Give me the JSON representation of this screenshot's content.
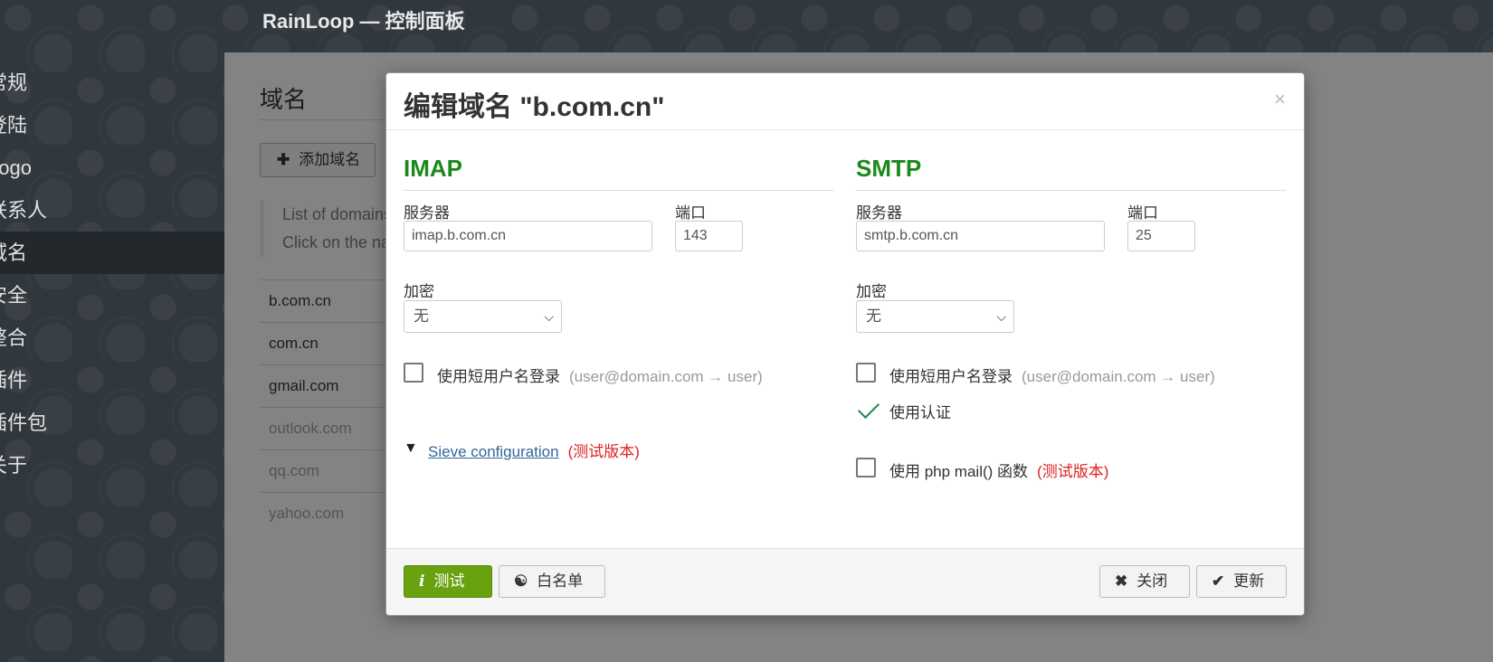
{
  "app": {
    "title": "RainLoop — 控制面板"
  },
  "menu": {
    "items": [
      {
        "label": "常规",
        "active": false
      },
      {
        "label": "登陆",
        "active": false
      },
      {
        "label": "Logo",
        "active": false
      },
      {
        "label": "联系人",
        "active": false
      },
      {
        "label": "域名",
        "active": true
      },
      {
        "label": "安全",
        "active": false
      },
      {
        "label": "整合",
        "active": false
      },
      {
        "label": "插件",
        "active": false
      },
      {
        "label": "插件包",
        "active": false
      },
      {
        "label": "关于",
        "active": false
      }
    ]
  },
  "domains": {
    "title": "域名",
    "add_button": "添加域名",
    "info_line1": "List of domains",
    "info_line2": "Click on the name",
    "list": [
      {
        "name": "b.com.cn",
        "enabled": true
      },
      {
        "name": "com.cn",
        "enabled": true
      },
      {
        "name": "gmail.com",
        "enabled": true
      },
      {
        "name": "outlook.com",
        "enabled": false
      },
      {
        "name": "qq.com",
        "enabled": false
      },
      {
        "name": "yahoo.com",
        "enabled": false
      }
    ]
  },
  "modal": {
    "title": "编辑域名 \"b.com.cn\"",
    "close": "×",
    "imap": {
      "heading": "IMAP",
      "server_label": "服务器",
      "server_value": "imap.b.com.cn",
      "port_label": "端口",
      "port_value": "143",
      "encryption_label": "加密",
      "encryption_value": "无",
      "short_login_label": "使用短用户名登录",
      "short_login_hint": "(user@domain.com → user)",
      "sieve_link": "Sieve configuration",
      "sieve_beta": "(测试版本)"
    },
    "smtp": {
      "heading": "SMTP",
      "server_label": "服务器",
      "server_value": "smtp.b.com.cn",
      "port_label": "端口",
      "port_value": "25",
      "encryption_label": "加密",
      "encryption_value": "无",
      "short_login_label": "使用短用户名登录",
      "short_login_hint": "(user@domain.com → user)",
      "auth_label": "使用认证",
      "php_mail_label": "使用 php mail() 函数",
      "php_mail_beta": "(测试版本)"
    },
    "footer": {
      "test_button": "测试",
      "whitelist_button": "白名单",
      "close_button": "关闭",
      "update_button": "更新"
    }
  }
}
